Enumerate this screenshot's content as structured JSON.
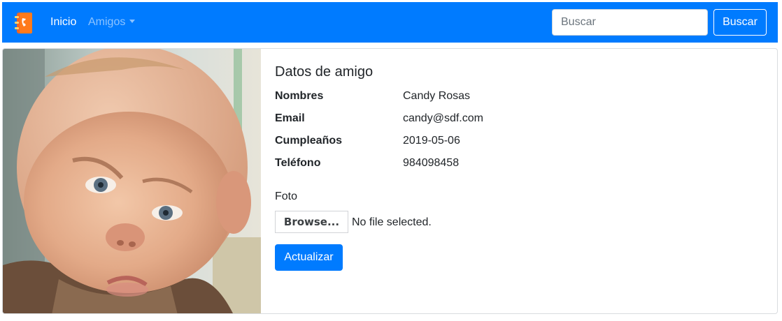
{
  "navbar": {
    "brand_icon": "phonebook-icon",
    "links": {
      "home": "Inicio",
      "friends": "Amigos"
    },
    "search": {
      "placeholder": "Buscar",
      "value": ""
    },
    "search_button": "Buscar",
    "background_color": "#007bff"
  },
  "card": {
    "title": "Datos de amigo",
    "fields": [
      {
        "label": "Nombres",
        "value": "Candy Rosas"
      },
      {
        "label": "Email",
        "value": "candy@sdf.com"
      },
      {
        "label": "Cumpleaños",
        "value": "2019-05-06"
      },
      {
        "label": "Teléfono",
        "value": "984098458"
      }
    ],
    "photo_label": "Foto",
    "file_input": {
      "button": "Browse...",
      "status": "No file selected."
    },
    "update_button": "Actualizar",
    "accent_color": "#007bff"
  }
}
